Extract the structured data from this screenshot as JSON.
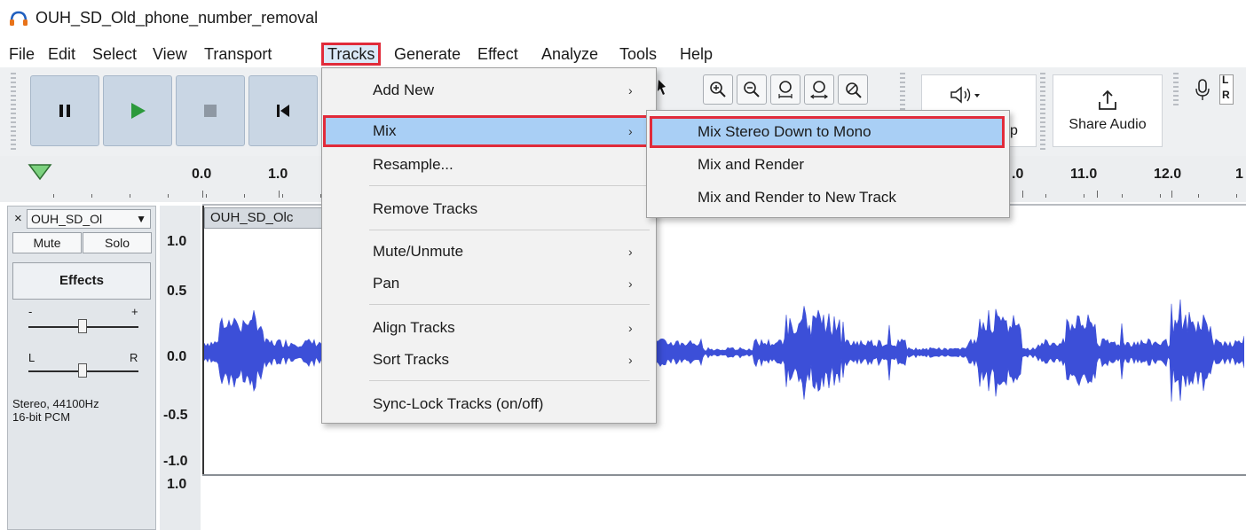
{
  "window": {
    "title": "OUH_SD_Old_phone_number_removal",
    "icon": "headphones-icon"
  },
  "menubar": [
    "File",
    "Edit",
    "Select",
    "View",
    "Transport",
    "Tracks",
    "Generate",
    "Effect",
    "Analyze",
    "Tools",
    "Help"
  ],
  "toolbar": {
    "transport_icons": [
      "pause-icon",
      "play-icon",
      "stop-icon",
      "skip-to-start-icon"
    ],
    "zoom_icons": [
      "zoom-in-icon",
      "zoom-out-icon",
      "fit-selection-icon",
      "fit-project-icon",
      "zoom-toggle-icon"
    ],
    "audio_setup_partial": "p",
    "audio_setup_icon": "speaker-icon",
    "share_audio_label": "Share Audio",
    "meter_labels": [
      "L",
      "R"
    ]
  },
  "ruler": {
    "ticks": [
      "0.0",
      "1.0",
      ".0",
      "11.0",
      "12.0",
      "1"
    ]
  },
  "track": {
    "close": "×",
    "name": "OUH_SD_Ol",
    "mute_label": "Mute",
    "solo_label": "Solo",
    "effects_label": "Effects",
    "gain_minus": "-",
    "gain_plus": "+",
    "pan_left": "L",
    "pan_right": "R",
    "format": "Stereo, 44100Hz\n16-bit PCM",
    "clip_name": "OUH_SD_Olc",
    "vruler_labels": [
      "1.0",
      "0.5",
      "0.0",
      "-0.5",
      "-1.0",
      "1.0"
    ],
    "wave_color": "#3c4fd8"
  },
  "tracks_menu": {
    "items": [
      {
        "label": "Add New",
        "submenu": true
      },
      {
        "label": "Mix",
        "submenu": true,
        "highlighted": true
      },
      {
        "label": "Resample...",
        "submenu": false
      },
      {
        "label": "Remove Tracks",
        "submenu": false
      },
      {
        "label": "Mute/Unmute",
        "submenu": true
      },
      {
        "label": "Pan",
        "submenu": true
      },
      {
        "label": "Align Tracks",
        "submenu": true
      },
      {
        "label": "Sort Tracks",
        "submenu": true
      },
      {
        "label": "Sync-Lock Tracks (on/off)",
        "submenu": false
      }
    ]
  },
  "mix_submenu": {
    "items": [
      {
        "label": "Mix Stereo Down to Mono",
        "highlighted": true
      },
      {
        "label": "Mix and Render",
        "highlighted": false
      },
      {
        "label": "Mix and Render to New Track",
        "highlighted": false
      }
    ]
  },
  "colors": {
    "highlight_border": "#e12b3a",
    "menu_hover": "#a9cff5"
  }
}
